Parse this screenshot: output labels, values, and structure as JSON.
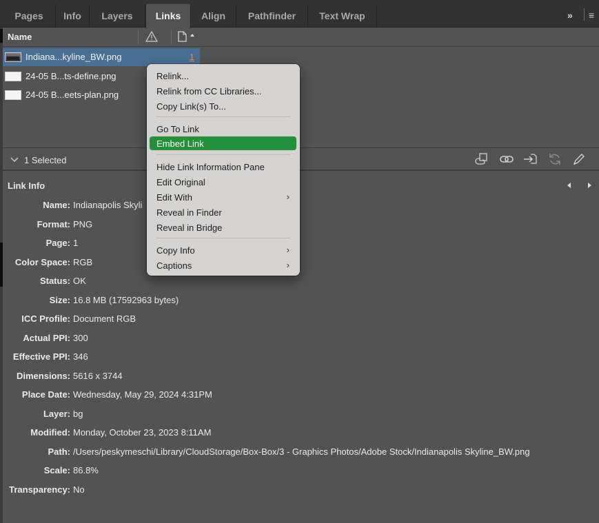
{
  "tabs": [
    {
      "label": "Pages",
      "active": false
    },
    {
      "label": "Info",
      "active": false
    },
    {
      "label": "Layers",
      "active": false
    },
    {
      "label": "Links",
      "active": true
    },
    {
      "label": "Align",
      "active": false
    },
    {
      "label": "Pathfinder",
      "active": false
    },
    {
      "label": "Text Wrap",
      "active": false
    }
  ],
  "tabbar": {
    "expand": "»",
    "menu": "≡"
  },
  "columns": {
    "name": "Name"
  },
  "links": [
    {
      "name": "Indiana...kyline_BW.png",
      "page": "1",
      "selected": true
    },
    {
      "name": "24-05 B...ts-define.png",
      "page": "",
      "selected": false
    },
    {
      "name": "24-05 B...eets-plan.png",
      "page": "",
      "selected": false
    }
  ],
  "selection": {
    "label": "1 Selected"
  },
  "link_info": {
    "title": "Link Info",
    "fields": [
      {
        "key": "Name:",
        "value": "Indianapolis Skyli"
      },
      {
        "key": "Format:",
        "value": "PNG"
      },
      {
        "key": "Page:",
        "value": "1"
      },
      {
        "key": "Color Space:",
        "value": "RGB"
      },
      {
        "key": "Status:",
        "value": "OK"
      },
      {
        "key": "Size:",
        "value": "16.8 MB (17592963 bytes)"
      },
      {
        "key": "ICC Profile:",
        "value": "Document RGB"
      },
      {
        "key": "Actual PPI:",
        "value": "300"
      },
      {
        "key": "Effective PPI:",
        "value": "346"
      },
      {
        "key": "Dimensions:",
        "value": "5616 x 3744"
      },
      {
        "key": "Place Date:",
        "value": "Wednesday, May 29, 2024 4:31PM"
      },
      {
        "key": "Layer:",
        "value": "bg"
      },
      {
        "key": "Modified:",
        "value": "Monday, October 23, 2023 8:11AM"
      },
      {
        "key": "Path:",
        "value": "/Users/peskymeschi/Library/CloudStorage/Box-Box/3 - Graphics Photos/Adobe Stock/Indianapolis Skyline_BW.png"
      },
      {
        "key": "Scale:",
        "value": "86.8%"
      },
      {
        "key": "Transparency:",
        "value": "No"
      }
    ]
  },
  "context_menu": {
    "items": [
      {
        "label": "Relink...",
        "submenu": false
      },
      {
        "label": "Relink from CC Libraries...",
        "submenu": false
      },
      {
        "label": "Copy Link(s) To...",
        "submenu": false
      },
      {
        "label": "Go To Link",
        "submenu": false
      },
      {
        "label": "Embed Link",
        "submenu": false,
        "highlighted": true
      },
      {
        "label": "Hide Link Information Pane",
        "submenu": false
      },
      {
        "label": "Edit Original",
        "submenu": false
      },
      {
        "label": "Edit With",
        "submenu": true
      },
      {
        "label": "Reveal in Finder",
        "submenu": false
      },
      {
        "label": "Reveal in Bridge",
        "submenu": false
      },
      {
        "label": "Copy Info",
        "submenu": true
      },
      {
        "label": "Captions",
        "submenu": true
      }
    ],
    "submenu_glyph": "›"
  },
  "colors": {
    "panel_bg": "#535353",
    "tabbar_bg": "#323232",
    "selection_row": "#4a6f95",
    "menu_bg": "#d4d3d1",
    "menu_highlight": "#23913a",
    "page_link": "#f08c3a"
  },
  "icons": {
    "status_column": "warning-icon",
    "page_column": "page-sort-icon",
    "toolbar": [
      "relink-from-cc-icon",
      "relink-icon",
      "go-to-link-icon",
      "update-link-icon",
      "edit-original-icon"
    ],
    "nav": [
      "previous-arrow-icon",
      "next-arrow-icon"
    ]
  }
}
